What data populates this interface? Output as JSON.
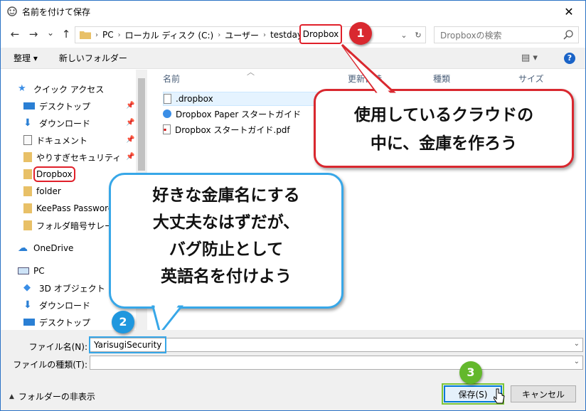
{
  "window": {
    "title": "名前を付けて保存",
    "close_glyph": "✕"
  },
  "nav": {
    "back": "←",
    "forward": "→",
    "recent": "⌄",
    "up": "↑",
    "address": {
      "segments": [
        "PC",
        "ローカル ディスク (C:)",
        "ユーザー",
        "testdayo",
        "Dropbox"
      ],
      "current": "Dropbox",
      "dropdown": "⌄",
      "refresh": "↻"
    },
    "search_placeholder": "Dropboxの検索"
  },
  "toolbar": {
    "organize": "整理 ▾",
    "new_folder": "新しいフォルダー",
    "view_glyph": "▤ ▾",
    "help": "?"
  },
  "sidebar": {
    "items": [
      {
        "label": "クイック アクセス",
        "icon": "star-icon",
        "pinned": false
      },
      {
        "label": "デスクトップ",
        "icon": "desktop-icon",
        "pinned": true
      },
      {
        "label": "ダウンロード",
        "icon": "download-icon",
        "pinned": true
      },
      {
        "label": "ドキュメント",
        "icon": "document-icon",
        "pinned": true
      },
      {
        "label": "やりすぎセキュリティ",
        "icon": "folder-icon",
        "pinned": true
      },
      {
        "label": "Dropbox",
        "icon": "folder-icon",
        "pinned": false,
        "selected": true
      },
      {
        "label": "folder",
        "icon": "folder-icon",
        "pinned": false
      },
      {
        "label": "KeePass Password S",
        "icon": "folder-icon",
        "pinned": false
      },
      {
        "label": "フォルダ暗号サレール",
        "icon": "folder-icon",
        "pinned": false
      },
      {
        "label": "OneDrive",
        "icon": "cloud-icon",
        "pinned": false
      },
      {
        "label": "PC",
        "icon": "pc-icon",
        "pinned": false
      },
      {
        "label": "3D オブジェクト",
        "icon": "cube-icon",
        "pinned": false
      },
      {
        "label": "ダウンロード",
        "icon": "download-icon",
        "pinned": false
      },
      {
        "label": "デスクトップ",
        "icon": "desktop-icon",
        "pinned": false
      }
    ]
  },
  "columns": {
    "name": "名前",
    "modified": "更新日時",
    "type": "種類",
    "size": "サイズ"
  },
  "files": [
    {
      "name": ".dropbox",
      "icon": "file-icon"
    },
    {
      "name": "Dropbox Paper スタートガイド",
      "icon": "web-shortcut-icon"
    },
    {
      "name": "Dropbox スタートガイド.pdf",
      "icon": "pdf-icon"
    }
  ],
  "form": {
    "filename_label": "ファイル名(N):",
    "filename_value": "YarisugiSecurity",
    "filetype_label": "ファイルの種類(T):",
    "filetype_value": "",
    "hide_folders": "フォルダーの非表示",
    "save": "保存(S)",
    "cancel": "キャンセル"
  },
  "annotations": {
    "badge1": "1",
    "badge2": "2",
    "badge3": "3",
    "callout1": [
      "使用しているクラウドの",
      "中に、金庫を作ろう"
    ],
    "callout2": [
      "好きな金庫名にする",
      "大丈夫なはずだが、",
      "バグ防止として",
      "英語名を付けよう"
    ],
    "colors": {
      "red": "#d9282f",
      "blue": "#37a7e8",
      "green": "#63b82c",
      "accent": "#0078d7"
    }
  }
}
